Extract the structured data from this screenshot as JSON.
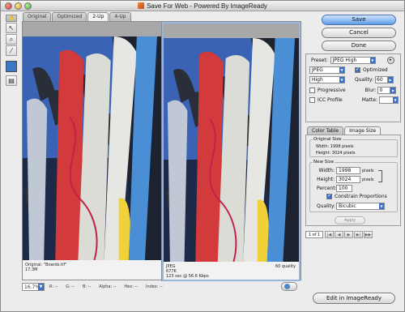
{
  "window": {
    "title": "Save For Web - Powered By ImageReady"
  },
  "tabs": [
    "Original",
    "Optimized",
    "2-Up",
    "4-Up"
  ],
  "tools": [
    "hand-tool-icon",
    "slice-select-tool-icon",
    "zoom-tool-icon",
    "eyedropper-tool-icon"
  ],
  "panes": {
    "original": {
      "line1": "Original: \"Boards.tif\"",
      "line2": "17.3M"
    },
    "optimized": {
      "line1": "JPEG",
      "line2": "677K",
      "line3": "123 sec @ 56.6 Kbps",
      "quality": "60 quality"
    }
  },
  "status": {
    "zoom": "16.7%",
    "r": "R: --",
    "g": "G: --",
    "b": "B: --",
    "alpha": "Alpha: --",
    "hex": "Hex: --",
    "index": "Index: --"
  },
  "buttons": {
    "save": "Save",
    "cancel": "Cancel",
    "done": "Done",
    "edit": "Edit in ImageReady",
    "apply": "Apply"
  },
  "settings": {
    "preset_label": "Preset:",
    "preset_value": "JPEG High",
    "format_value": "JPEG",
    "quality_mode": "High",
    "quality_label": "Quality:",
    "quality_value": "60",
    "optimized_label": "Optimized",
    "progressive_label": "Progressive",
    "blur_label": "Blur:",
    "blur_value": "0",
    "icc_label": "ICC Profile",
    "matte_label": "Matte:"
  },
  "image_tabs": [
    "Color Table",
    "Image Size"
  ],
  "image_size": {
    "original_label": "Original Size",
    "orig_width": "Width: 1998 pixels",
    "orig_height": "Height: 3024 pixels",
    "new_label": "New Size",
    "width_label": "Width:",
    "width_value": "1998",
    "height_label": "Height:",
    "height_value": "3024",
    "pixels": "pixels",
    "percent_label": "Percent:",
    "percent_value": "100",
    "constrain_label": "Constrain Proportions",
    "quality_label": "Quality:",
    "quality_value": "Bicubic"
  },
  "animation": {
    "frame": "1 of 1"
  }
}
